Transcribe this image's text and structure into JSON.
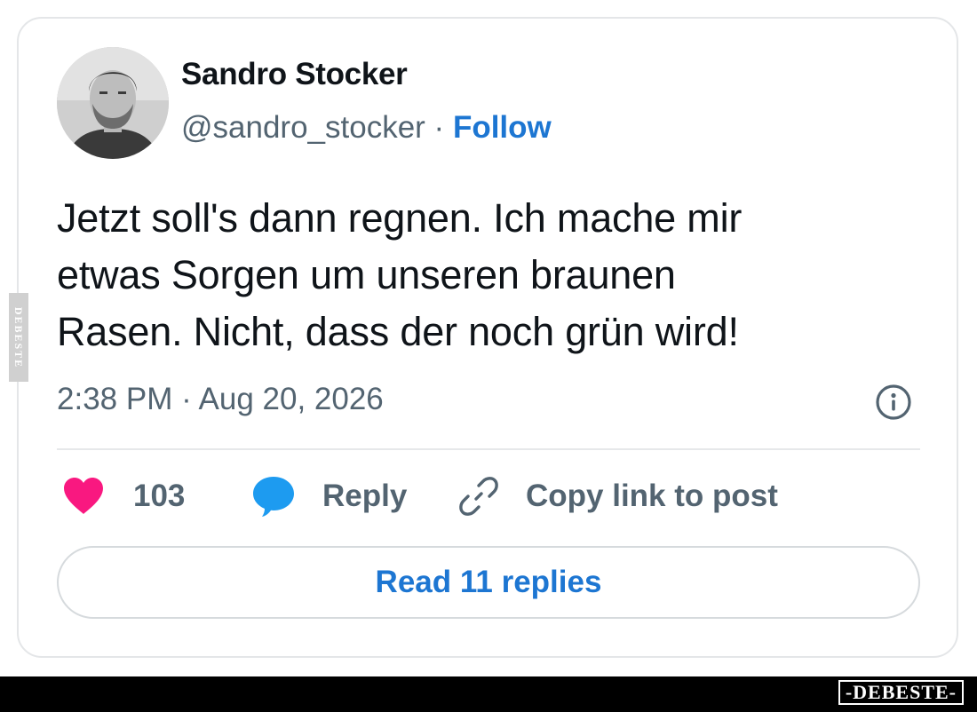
{
  "tweet": {
    "author": {
      "name": "Sandro Stocker",
      "handle": "@sandro_stocker",
      "separator": " · ",
      "follow_label": "Follow"
    },
    "text_lines": [
      "Jetzt soll's dann regnen. Ich mache mir",
      "etwas Sorgen um unseren braunen",
      "Rasen. Nicht, dass der noch grün wird!"
    ],
    "timestamp": "2:38 PM · Aug 20, 2026",
    "actions": {
      "like_count": "103",
      "reply_label": "Reply",
      "copy_link_label": "Copy link to post"
    },
    "read_replies_label": "Read 11 replies"
  },
  "watermarks": {
    "side": "DEBESTE",
    "bottom": "-DEBESTE-"
  },
  "colors": {
    "link_blue": "#1d76d2",
    "heart_pink": "#f91880",
    "reply_blue": "#1d9bf0",
    "muted_text": "#536471",
    "primary_text": "#0f1419"
  },
  "icons": {
    "like": "heart-icon",
    "reply": "speech-bubble-icon",
    "copy_link": "link-icon",
    "info": "info-icon"
  }
}
